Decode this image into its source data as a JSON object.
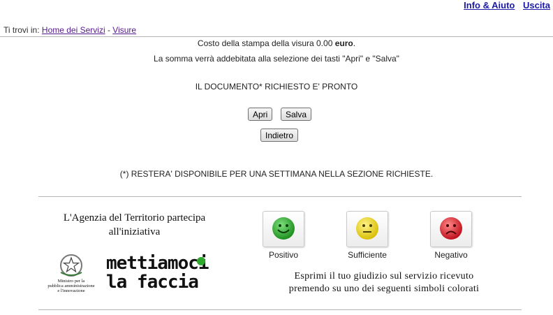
{
  "header": {
    "links": [
      "Info & Aiuto",
      "Uscita"
    ]
  },
  "breadcrumb": {
    "prefix": "Ti trovi in:",
    "items": [
      "Home dei Servizi",
      "Visure"
    ],
    "separator": "-"
  },
  "main": {
    "cost_prefix": "Costo della stampa della visura 0.00 ",
    "cost_unit": "euro",
    "cost_suffix": ".",
    "charge_note": "La somma verrà addebitata alla selezione dei tasti \"Apri\" e \"Salva\"",
    "ready_message": "IL DOCUMENTO* RICHIESTO E' PRONTO",
    "buttons": {
      "open": "Apri",
      "save": "Salva",
      "back": "Indietro"
    },
    "footnote": "(*) RESTERA' DISPONIBILE PER UNA SETTIMANA NELLA SEZIONE RICHIESTE."
  },
  "footer": {
    "agency_text_line1": "L'Agenzia del Territorio partecipa",
    "agency_text_line2": "all'iniziativa",
    "ministry_lines": [
      "Ministro per la",
      "pubblica amministrazione",
      "e l'innovazione"
    ],
    "logo_line1": "mettiamoci",
    "logo_line2": "la faccia",
    "ratings": [
      {
        "label": "Positivo",
        "color": "#2faa2f",
        "icon": "happy-face-icon"
      },
      {
        "label": "Sufficiente",
        "color": "#e8d21a",
        "icon": "neutral-face-icon"
      },
      {
        "label": "Negativo",
        "color": "#d81f2a",
        "icon": "sad-face-icon"
      }
    ],
    "feedback_line1": "Esprimi il tuo giudizio sul servizio ricevuto",
    "feedback_line2": "premendo su uno dei seguenti simboli colorati"
  }
}
